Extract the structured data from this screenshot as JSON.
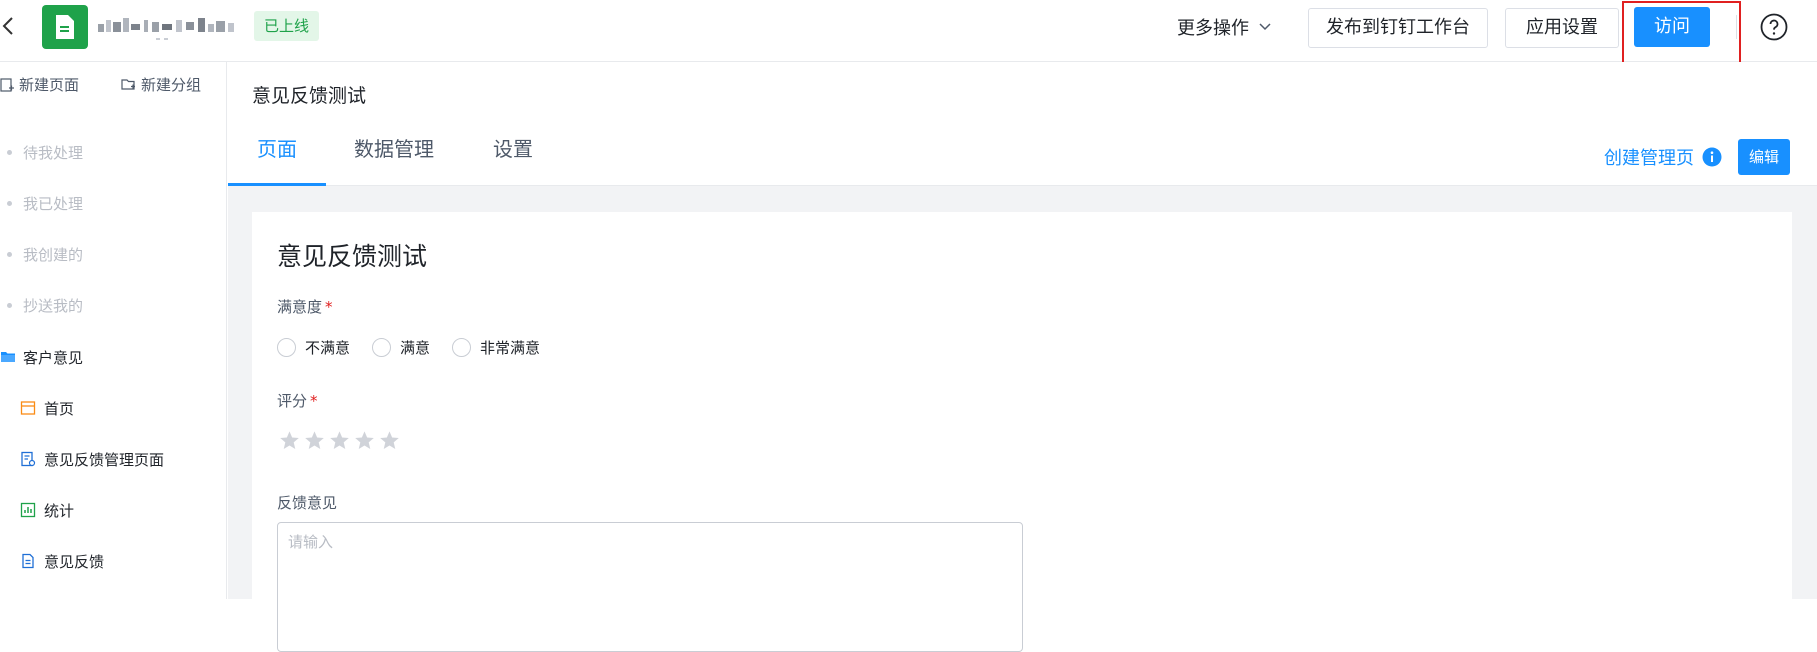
{
  "header": {
    "app_name": "",
    "status": "已上线",
    "more_ops": "更多操作",
    "publish": "发布到钉钉工作台",
    "app_settings": "应用设置",
    "visit": "访问"
  },
  "sidebar": {
    "new_page": "新建页面",
    "new_group": "新建分组",
    "items": [
      {
        "label": "待我处理"
      },
      {
        "label": "我已处理"
      },
      {
        "label": "我创建的"
      },
      {
        "label": "抄送我的"
      }
    ],
    "group": {
      "label": "客户意见",
      "children": [
        {
          "label": "首页",
          "icon": "layout-icon"
        },
        {
          "label": "意见反馈管理页面",
          "icon": "manage-page-icon"
        },
        {
          "label": "统计",
          "icon": "chart-icon"
        },
        {
          "label": "意见反馈",
          "icon": "form-doc-icon"
        }
      ]
    }
  },
  "main": {
    "page_title": "意见反馈测试",
    "tabs": [
      {
        "label": "页面",
        "active": true
      },
      {
        "label": "数据管理",
        "active": false
      },
      {
        "label": "设置",
        "active": false
      }
    ],
    "create_manage": "创建管理页",
    "edit": "编辑"
  },
  "form": {
    "title": "意见反馈测试",
    "satisfaction_label": "满意度",
    "required_mark": "*",
    "options": [
      "不满意",
      "满意",
      "非常满意"
    ],
    "rating_label": "评分",
    "rating_value": 0,
    "rating_max": 5,
    "feedback_label": "反馈意见",
    "feedback_placeholder": "请输入"
  },
  "colors": {
    "accent": "#1890ff",
    "brand_green": "#1fa24a",
    "highlight_red": "#e02020"
  }
}
